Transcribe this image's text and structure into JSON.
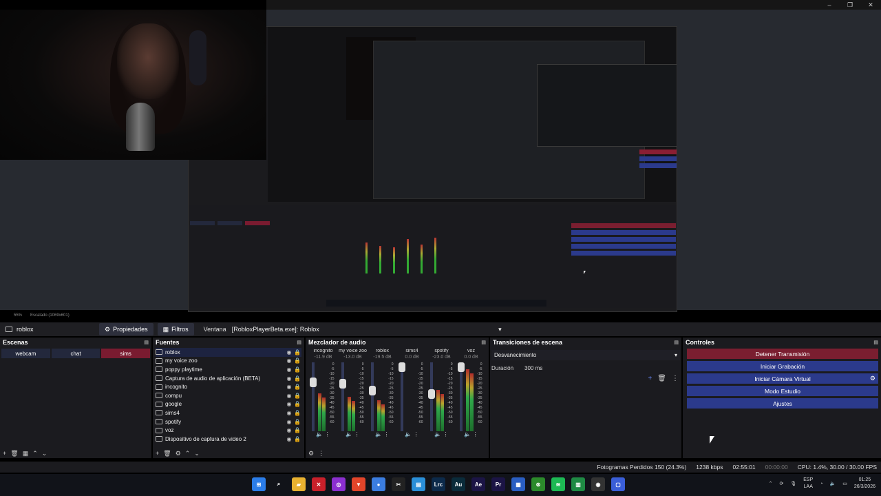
{
  "window": {
    "controls": [
      "–",
      "❐",
      "✕"
    ]
  },
  "preview": {
    "zoom": "55%",
    "scaling": "Escalado (1069x601)"
  },
  "source_toolbar": {
    "current_source": "roblox",
    "properties_label": "Propiedades",
    "filters_label": "Filtros",
    "window_label": "Ventana",
    "window_value": "[RobloxPlayerBeta.exe]: Roblox"
  },
  "scenes": {
    "title": "Escenas",
    "items": [
      {
        "label": "webcam",
        "active": false
      },
      {
        "label": "chat",
        "active": false
      },
      {
        "label": "sims",
        "active": true
      }
    ]
  },
  "sources": {
    "title": "Fuentes",
    "items": [
      {
        "label": "roblox",
        "icon": "window-capture-icon",
        "selected": true
      },
      {
        "label": "my voice zoo",
        "icon": "window-capture-icon"
      },
      {
        "label": "poppy playtime",
        "icon": "window-capture-icon"
      },
      {
        "label": "Captura de audio de aplicación (BETA)",
        "icon": "window-capture-icon"
      },
      {
        "label": "incognito",
        "icon": "window-capture-icon"
      },
      {
        "label": "compu",
        "icon": "window-capture-icon"
      },
      {
        "label": "google",
        "icon": "window-capture-icon"
      },
      {
        "label": "sims4",
        "icon": "window-capture-icon"
      },
      {
        "label": "spotify",
        "icon": "window-capture-icon"
      },
      {
        "label": "voz",
        "icon": "microphone-icon"
      },
      {
        "label": "Dispositivo de captura de video 2",
        "icon": "camera-icon"
      }
    ]
  },
  "mixer": {
    "title": "Mezclador de audio",
    "scale": [
      "0",
      "-5",
      "-10",
      "-15",
      "-20",
      "-25",
      "-30",
      "-35",
      "-40",
      "-45",
      "-50",
      "-55",
      "-60"
    ],
    "channels": [
      {
        "name": "incognito",
        "db": "-11.9 dB",
        "level": 0.55,
        "fader": 0.75,
        "muted": false
      },
      {
        "name": "my voice zoo",
        "db": "-13.0 dB",
        "level": 0.5,
        "fader": 0.72,
        "muted": false
      },
      {
        "name": "roblox",
        "db": "-19.5 dB",
        "level": 0.45,
        "fader": 0.6,
        "muted": false
      },
      {
        "name": "sims4",
        "db": "0.0 dB",
        "level": 0.0,
        "fader": 1.0,
        "muted": true
      },
      {
        "name": "spotify",
        "db": "-23.0 dB",
        "level": 0.6,
        "fader": 0.55,
        "muted": false
      },
      {
        "name": "voz",
        "db": "0.0 dB",
        "level": 0.9,
        "fader": 1.0,
        "muted": false
      }
    ]
  },
  "transitions": {
    "title": "Transiciones de escena",
    "selected": "Desvanecimiento",
    "duration_label": "Duración",
    "duration_value": "300 ms"
  },
  "controls": {
    "title": "Controles",
    "stop_stream": "Detener Transmisión",
    "start_recording": "Iniciar Grabación",
    "virtual_camera": "Iniciar Cámara Virtual",
    "studio_mode": "Modo Estudio",
    "settings": "Ajustes"
  },
  "status": {
    "dropped_frames": "Fotogramas Perdidos 150 (24.3%)",
    "bitrate": "1238 kbps",
    "stream_time": "02:55:01",
    "rec_time": "00:00:00",
    "cpu": "CPU: 1.4%, 30.00 / 30.00 FPS"
  },
  "taskbar": {
    "apps": [
      {
        "name": "windows-start-icon",
        "color": "#2b7de9",
        "glyph": "⊞"
      },
      {
        "name": "search-icon",
        "color": "transparent",
        "glyph": "⌕"
      },
      {
        "name": "file-explorer-icon",
        "color": "#e8b130",
        "glyph": "▰"
      },
      {
        "name": "app-x-icon",
        "color": "#c8202a",
        "glyph": "✕"
      },
      {
        "name": "app-purple-icon",
        "color": "#8b2fd0",
        "glyph": "◎"
      },
      {
        "name": "brave-icon",
        "color": "#e2452a",
        "glyph": "▼"
      },
      {
        "name": "chrome-icon",
        "color": "#3b7de0",
        "glyph": "●"
      },
      {
        "name": "capcut-icon",
        "color": "#222",
        "glyph": "✂"
      },
      {
        "name": "notepad-icon",
        "color": "#2a8fd8",
        "glyph": "▤"
      },
      {
        "name": "lightroom-icon",
        "color": "#0c2a4a",
        "glyph": "Lrc"
      },
      {
        "name": "audition-icon",
        "color": "#0a2b3a",
        "glyph": "Au"
      },
      {
        "name": "after-effects-icon",
        "color": "#1b1445",
        "glyph": "Ae"
      },
      {
        "name": "premiere-icon",
        "color": "#1b1445",
        "glyph": "Pr"
      },
      {
        "name": "app-blue-icon",
        "color": "#2a5ec2",
        "glyph": "▦"
      },
      {
        "name": "xbox-icon",
        "color": "#2b8a2b",
        "glyph": "⊗"
      },
      {
        "name": "spotify-icon",
        "color": "#1db954",
        "glyph": "≋"
      },
      {
        "name": "sheets-icon",
        "color": "#1f8a44",
        "glyph": "▥"
      },
      {
        "name": "obs-icon",
        "color": "#333",
        "glyph": "◉"
      },
      {
        "name": "app-window-icon",
        "color": "#3a5ed8",
        "glyph": "▢"
      }
    ],
    "language": "ESP",
    "layout": "LAA",
    "time": "01:25",
    "date": "26/3/2026"
  }
}
